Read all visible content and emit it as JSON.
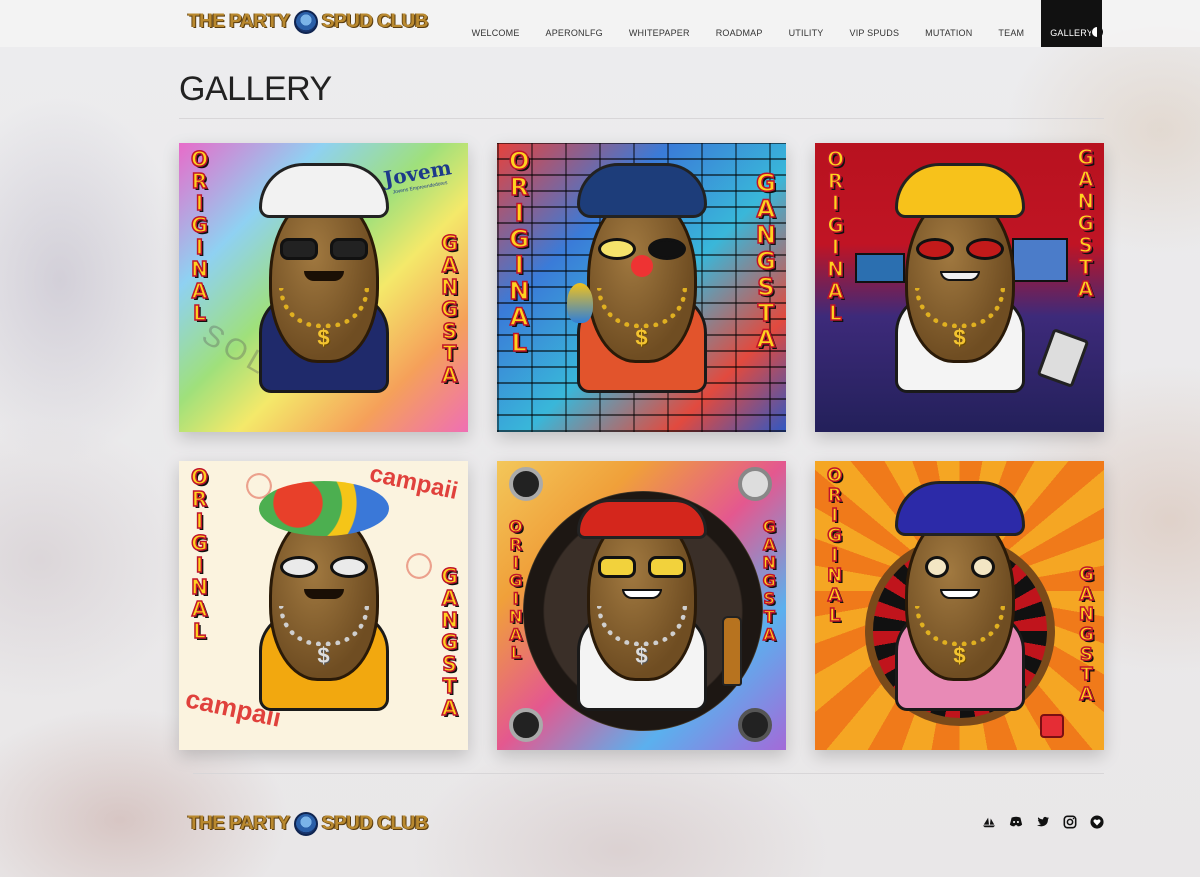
{
  "brand": {
    "logo_left": "THE PARTY",
    "logo_right": "SPUD CLUB"
  },
  "nav": {
    "items": [
      {
        "label": "WELCOME"
      },
      {
        "label": "APERONLFG"
      },
      {
        "label": "WHITEPAPER"
      },
      {
        "label": "ROADMAP"
      },
      {
        "label": "UTILITY"
      },
      {
        "label": "VIP SPUDS"
      },
      {
        "label": "MUTATION"
      },
      {
        "label": "TEAM"
      },
      {
        "label": "GALLERY",
        "active": true
      }
    ],
    "theme_toggle_icon": "contrast-icon"
  },
  "page": {
    "title": "GALLERY"
  },
  "gallery": {
    "cards": [
      {
        "left_word": "ORIGINAL",
        "right_word": "GANGSTA",
        "sponsor_text": "Jovem",
        "sponsor_sub": "Jovens Empreendedores",
        "watermark": "SOLID",
        "bg": "rainbow",
        "shirt_color": "#1f2a6b",
        "hat_color": "#f2f2f2"
      },
      {
        "left_word": "ORIGINAL",
        "right_word": "GANGSTA",
        "bg": "brick",
        "shirt_color": "#e2542c",
        "hat_color": "#1d3d7a"
      },
      {
        "left_word": "ORIGINAL",
        "right_word": "GANGSTA",
        "bg": "office",
        "shirt_color": "#f4f4f4",
        "hat_color": "#f7c21b"
      },
      {
        "left_word": "ORIGINAL",
        "right_word": "GANGSTA",
        "sponsor_text": "campaii",
        "bg": "confetti",
        "shirt_color": "#f2a80f",
        "hat_color": "#e8402a"
      },
      {
        "left_word": "ORIGINAL",
        "right_word": "GANGSTA",
        "bg": "clock",
        "shirt_color": "#f4f4f4",
        "hat_color": "#d4261c"
      },
      {
        "left_word": "ORIGINAL",
        "right_word": "GANGSTA",
        "bg": "casino",
        "shirt_color": "#e88ab6",
        "hat_color": "#2c2aa8"
      }
    ]
  },
  "footer": {
    "logo_left": "THE PARTY",
    "logo_right": "SPUD CLUB",
    "socials": [
      "opensea-icon",
      "discord-icon",
      "twitter-icon",
      "instagram-icon",
      "heart-icon"
    ]
  },
  "colors": {
    "accent_dark": "#111111",
    "logo_gold": "#b9892f",
    "word_yellow": "#ffd21f",
    "word_red": "#c0142a"
  }
}
